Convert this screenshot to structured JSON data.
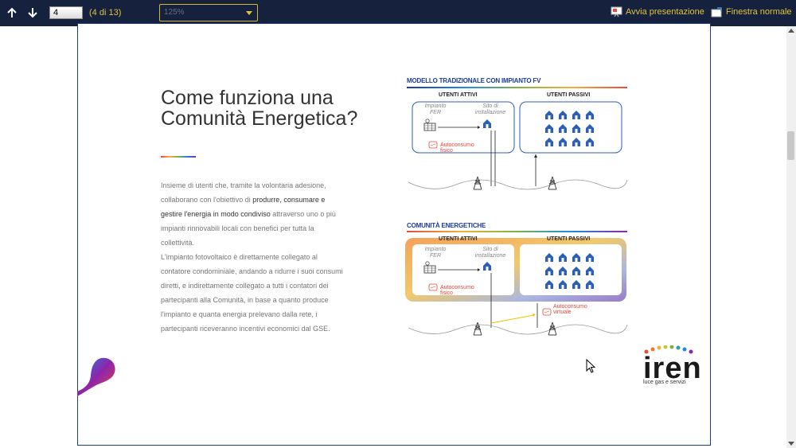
{
  "toolbar": {
    "page_value": "4",
    "page_count": "(4 di 13)",
    "zoom_value": "125%",
    "start_presentation": "Avvia presentazione",
    "normal_window": "Finestra normale"
  },
  "slide": {
    "title": "Come funziona una Comunità Energetica?",
    "paragraph1_a": "Insieme di utenti che, tramite la volontaria adesione, collaborano con l'obiettivo di ",
    "paragraph1_b": "produrre, consumare e gestire l'energia in modo condiviso",
    "paragraph1_c": " attraverso uno o più impianti rinnovabili locali con benefici per tutta la collettività.",
    "paragraph2": "L'impianto fotovoltaico è direttamente collegato al contatore condominiale, andando a ridurre i suoi consumi diretti, e indirettamente collegato a tutti i contatori dei partecipanti alla Comunità, in base a quanto produce l'impianto e quanta energia prelevano dalla rete, i partecipanti riceveranno incentivi economici dal GSE.",
    "diagram_top": {
      "title": "MODELLO TRADIZIONALE CON IMPIANTO FV",
      "active_users": "UTENTI ATTIVI",
      "passive_users": "UTENTI PASSIVI",
      "plant_label": "Impianto FER",
      "site_label": "Sito di installazione",
      "self_consumption": "Autoconsumo fisico"
    },
    "diagram_bottom": {
      "title": "COMUNITÀ ENERGETICHE",
      "active_users": "UTENTI ATTIVI",
      "passive_users": "UTENTI PASSIVI",
      "plant_label": "Impianto FER",
      "site_label": "Sito di installazione",
      "self_consumption": "Autoconsumo fisico",
      "virtual_consumption": "Autoconsumo virtuale"
    },
    "logo_name": "iren",
    "logo_tagline": "luce gas e servizi"
  },
  "colors": {
    "toolbar_bg": "#16213e",
    "toolbar_accent": "#e0c43a",
    "diagram_blue": "#1d3c9a",
    "house_blue": "#2c5fb5",
    "accent_red": "#e8453c"
  }
}
